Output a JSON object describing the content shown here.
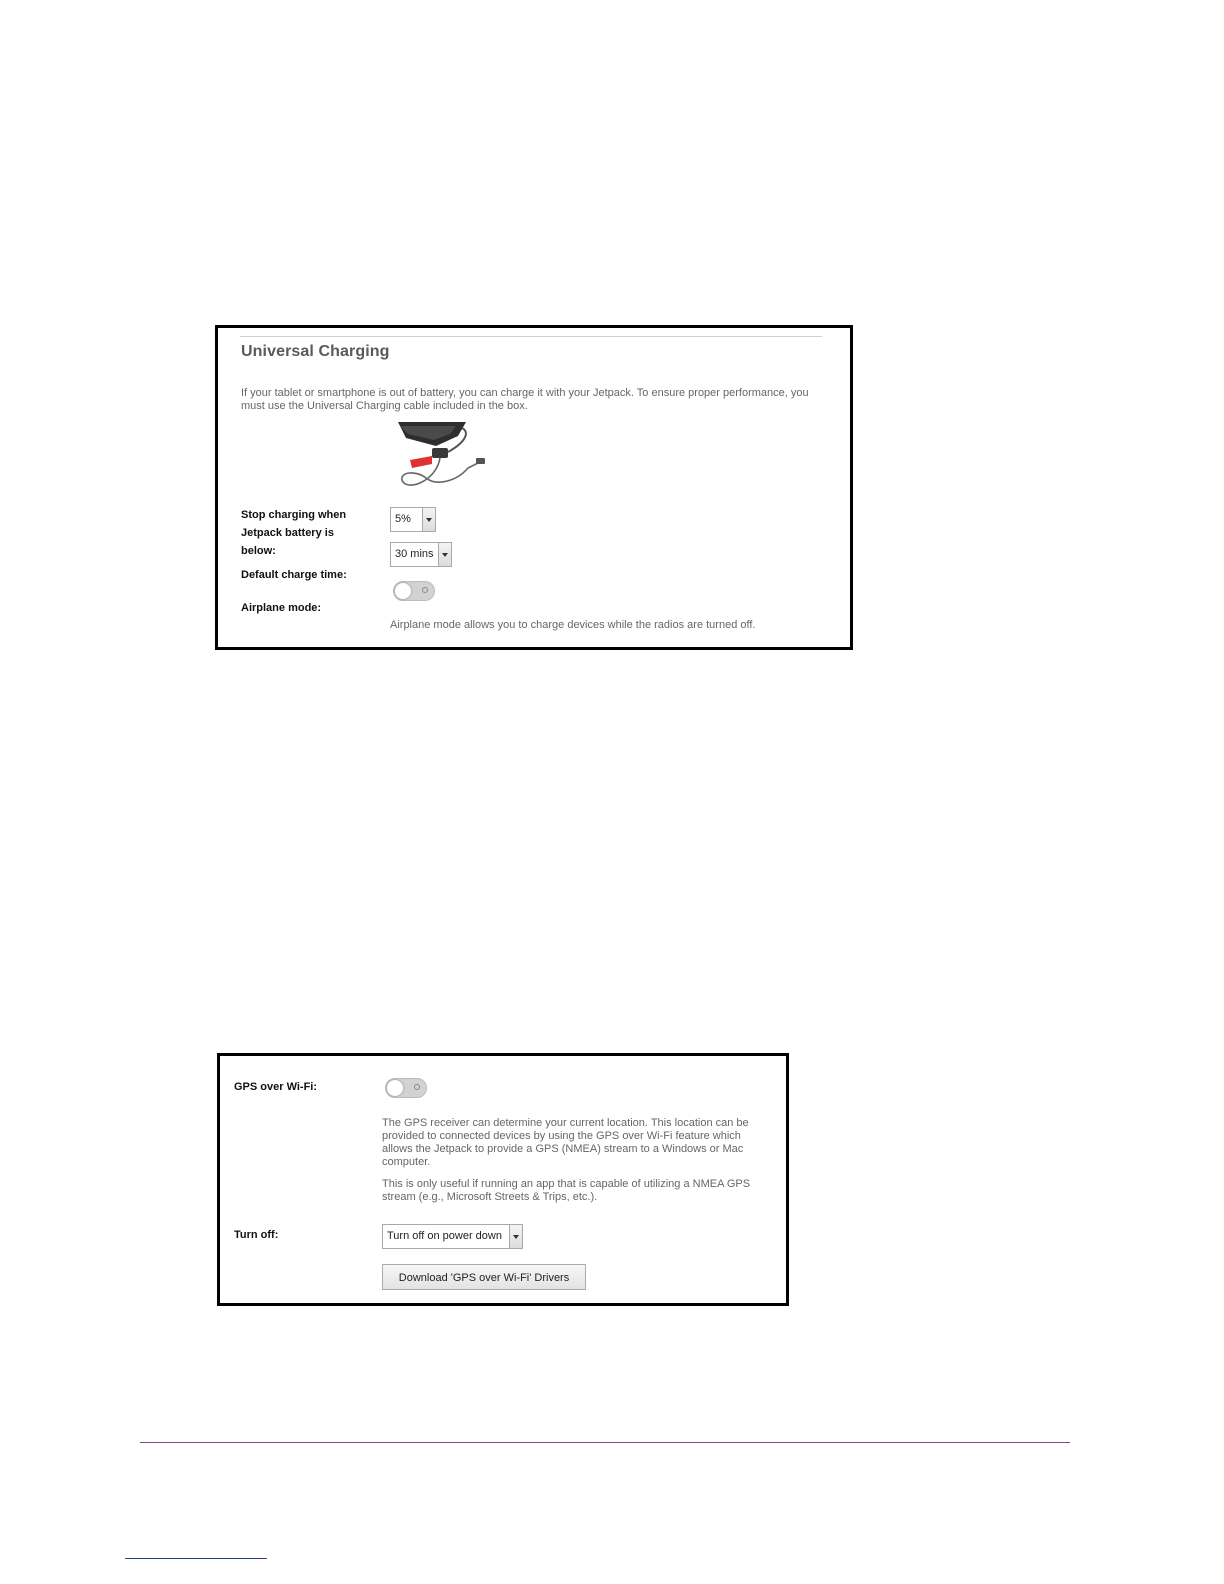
{
  "universal_charging": {
    "title": "Universal Charging",
    "description": "If your tablet or smartphone is out of battery, you can charge it with your Jetpack. To ensure proper performance, you must use the Universal Charging cable included in the box.",
    "stop_label": "Stop charging when Jetpack battery is below:",
    "stop_value": "5%",
    "default_time_label": "Default charge time:",
    "default_time_value": "30 mins",
    "airplane_label": "Airplane mode:",
    "airplane_on": false,
    "airplane_note": "Airplane mode allows you to charge devices while the radios are turned off."
  },
  "gps": {
    "gps_label": "GPS over Wi-Fi:",
    "gps_on": false,
    "desc1": "The GPS receiver can determine your current location. This location can be provided to connected devices by using the GPS over Wi-Fi feature which allows the Jetpack to provide a GPS (NMEA) stream to a Windows or Mac computer.",
    "desc2": "This is only useful if running an app that is capable of utilizing a NMEA GPS stream (e.g., Microsoft Streets & Trips, etc.).",
    "turn_off_label": "Turn off:",
    "turn_off_value": "Turn off on power down",
    "download_label": "Download 'GPS over Wi-Fi' Drivers"
  },
  "colors": {
    "footer_rule": "#7b4a8c",
    "link_rule": "#2c3e94"
  }
}
